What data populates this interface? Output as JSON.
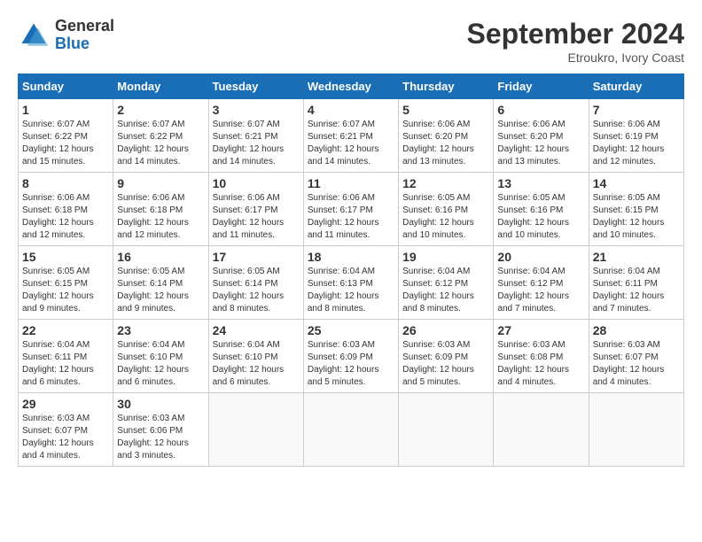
{
  "header": {
    "logo": {
      "general": "General",
      "blue": "Blue"
    },
    "title": "September 2024",
    "location": "Etroukro, Ivory Coast"
  },
  "calendar": {
    "weekdays": [
      "Sunday",
      "Monday",
      "Tuesday",
      "Wednesday",
      "Thursday",
      "Friday",
      "Saturday"
    ],
    "weeks": [
      [
        null,
        null,
        null,
        null,
        null,
        null,
        null
      ]
    ]
  },
  "days": [
    {
      "date": 1,
      "dow": 0,
      "sunrise": "6:07 AM",
      "sunset": "6:22 PM",
      "daylight": "12 hours and 15 minutes."
    },
    {
      "date": 2,
      "dow": 1,
      "sunrise": "6:07 AM",
      "sunset": "6:22 PM",
      "daylight": "12 hours and 14 minutes."
    },
    {
      "date": 3,
      "dow": 2,
      "sunrise": "6:07 AM",
      "sunset": "6:21 PM",
      "daylight": "12 hours and 14 minutes."
    },
    {
      "date": 4,
      "dow": 3,
      "sunrise": "6:07 AM",
      "sunset": "6:21 PM",
      "daylight": "12 hours and 14 minutes."
    },
    {
      "date": 5,
      "dow": 4,
      "sunrise": "6:06 AM",
      "sunset": "6:20 PM",
      "daylight": "12 hours and 13 minutes."
    },
    {
      "date": 6,
      "dow": 5,
      "sunrise": "6:06 AM",
      "sunset": "6:20 PM",
      "daylight": "12 hours and 13 minutes."
    },
    {
      "date": 7,
      "dow": 6,
      "sunrise": "6:06 AM",
      "sunset": "6:19 PM",
      "daylight": "12 hours and 12 minutes."
    },
    {
      "date": 8,
      "dow": 0,
      "sunrise": "6:06 AM",
      "sunset": "6:18 PM",
      "daylight": "12 hours and 12 minutes."
    },
    {
      "date": 9,
      "dow": 1,
      "sunrise": "6:06 AM",
      "sunset": "6:18 PM",
      "daylight": "12 hours and 12 minutes."
    },
    {
      "date": 10,
      "dow": 2,
      "sunrise": "6:06 AM",
      "sunset": "6:17 PM",
      "daylight": "12 hours and 11 minutes."
    },
    {
      "date": 11,
      "dow": 3,
      "sunrise": "6:06 AM",
      "sunset": "6:17 PM",
      "daylight": "12 hours and 11 minutes."
    },
    {
      "date": 12,
      "dow": 4,
      "sunrise": "6:05 AM",
      "sunset": "6:16 PM",
      "daylight": "12 hours and 10 minutes."
    },
    {
      "date": 13,
      "dow": 5,
      "sunrise": "6:05 AM",
      "sunset": "6:16 PM",
      "daylight": "12 hours and 10 minutes."
    },
    {
      "date": 14,
      "dow": 6,
      "sunrise": "6:05 AM",
      "sunset": "6:15 PM",
      "daylight": "12 hours and 10 minutes."
    },
    {
      "date": 15,
      "dow": 0,
      "sunrise": "6:05 AM",
      "sunset": "6:15 PM",
      "daylight": "12 hours and 9 minutes."
    },
    {
      "date": 16,
      "dow": 1,
      "sunrise": "6:05 AM",
      "sunset": "6:14 PM",
      "daylight": "12 hours and 9 minutes."
    },
    {
      "date": 17,
      "dow": 2,
      "sunrise": "6:05 AM",
      "sunset": "6:14 PM",
      "daylight": "12 hours and 8 minutes."
    },
    {
      "date": 18,
      "dow": 3,
      "sunrise": "6:04 AM",
      "sunset": "6:13 PM",
      "daylight": "12 hours and 8 minutes."
    },
    {
      "date": 19,
      "dow": 4,
      "sunrise": "6:04 AM",
      "sunset": "6:12 PM",
      "daylight": "12 hours and 8 minutes."
    },
    {
      "date": 20,
      "dow": 5,
      "sunrise": "6:04 AM",
      "sunset": "6:12 PM",
      "daylight": "12 hours and 7 minutes."
    },
    {
      "date": 21,
      "dow": 6,
      "sunrise": "6:04 AM",
      "sunset": "6:11 PM",
      "daylight": "12 hours and 7 minutes."
    },
    {
      "date": 22,
      "dow": 0,
      "sunrise": "6:04 AM",
      "sunset": "6:11 PM",
      "daylight": "12 hours and 6 minutes."
    },
    {
      "date": 23,
      "dow": 1,
      "sunrise": "6:04 AM",
      "sunset": "6:10 PM",
      "daylight": "12 hours and 6 minutes."
    },
    {
      "date": 24,
      "dow": 2,
      "sunrise": "6:04 AM",
      "sunset": "6:10 PM",
      "daylight": "12 hours and 6 minutes."
    },
    {
      "date": 25,
      "dow": 3,
      "sunrise": "6:03 AM",
      "sunset": "6:09 PM",
      "daylight": "12 hours and 5 minutes."
    },
    {
      "date": 26,
      "dow": 4,
      "sunrise": "6:03 AM",
      "sunset": "6:09 PM",
      "daylight": "12 hours and 5 minutes."
    },
    {
      "date": 27,
      "dow": 5,
      "sunrise": "6:03 AM",
      "sunset": "6:08 PM",
      "daylight": "12 hours and 4 minutes."
    },
    {
      "date": 28,
      "dow": 6,
      "sunrise": "6:03 AM",
      "sunset": "6:07 PM",
      "daylight": "12 hours and 4 minutes."
    },
    {
      "date": 29,
      "dow": 0,
      "sunrise": "6:03 AM",
      "sunset": "6:07 PM",
      "daylight": "12 hours and 4 minutes."
    },
    {
      "date": 30,
      "dow": 1,
      "sunrise": "6:03 AM",
      "sunset": "6:06 PM",
      "daylight": "12 hours and 3 minutes."
    }
  ],
  "labels": {
    "sunrise": "Sunrise:",
    "sunset": "Sunset:",
    "daylight": "Daylight:"
  }
}
